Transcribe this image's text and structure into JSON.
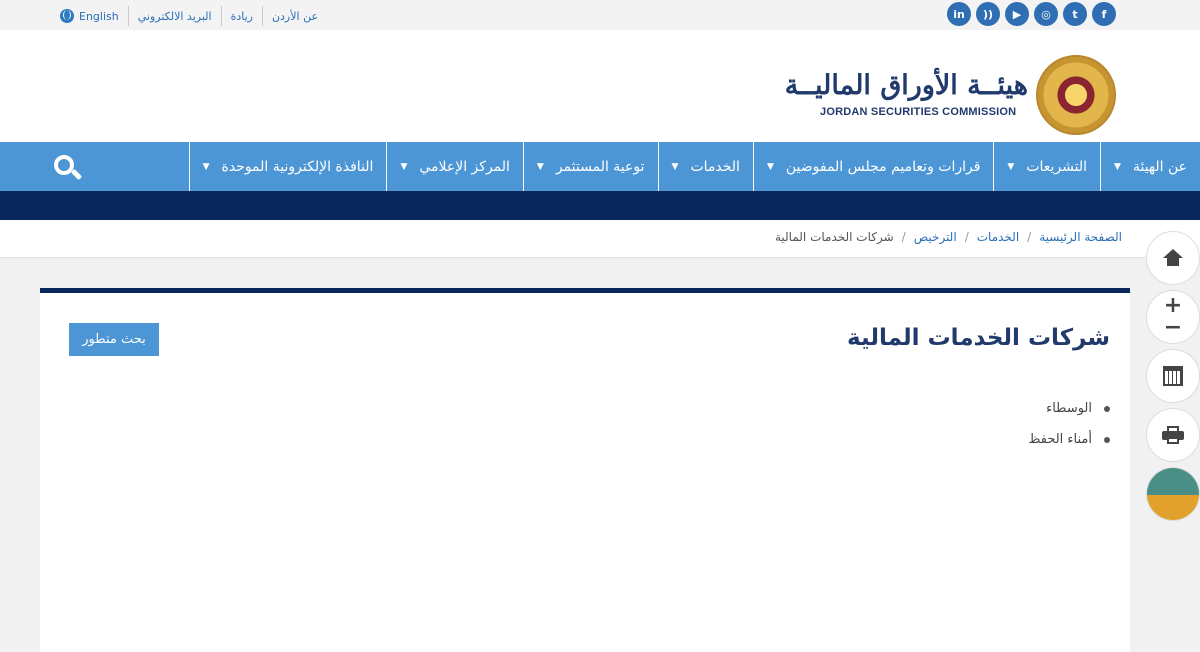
{
  "topbar": {
    "links": [
      "English",
      "البريد الالكتروني",
      "ريادة",
      "عن الأردن"
    ],
    "social": [
      "facebook-icon",
      "twitter-icon",
      "instagram-icon",
      "youtube-icon",
      "rss-icon",
      "linkedin-icon"
    ]
  },
  "header": {
    "logo_ar": "هيئــة الأوراق الماليــة",
    "logo_en": "JORDAN SECURITIES COMMISSION"
  },
  "nav": {
    "items": [
      {
        "label": "عن الهيئة"
      },
      {
        "label": "التشريعات"
      },
      {
        "label": "قرارات وتعاميم مجلس المفوضين"
      },
      {
        "label": "الخدمات"
      },
      {
        "label": "توعية المستثمر"
      },
      {
        "label": "المركز الإعلامي"
      },
      {
        "label": "النافذة الإلكترونية الموحدة"
      }
    ]
  },
  "breadcrumb": {
    "items": [
      "الصفحة الرئيسية",
      "الخدمات",
      "الترخيص",
      "شركات الخدمات المالية"
    ]
  },
  "main": {
    "title": "شركات الخدمات المالية",
    "advanced_search": "بحث متطور",
    "list": [
      "الوسطاء",
      "أمناء الحفظ"
    ]
  },
  "colors": {
    "nav_blue": "#4d96d6",
    "navy": "#09275c",
    "title_blue": "#213a6d"
  }
}
